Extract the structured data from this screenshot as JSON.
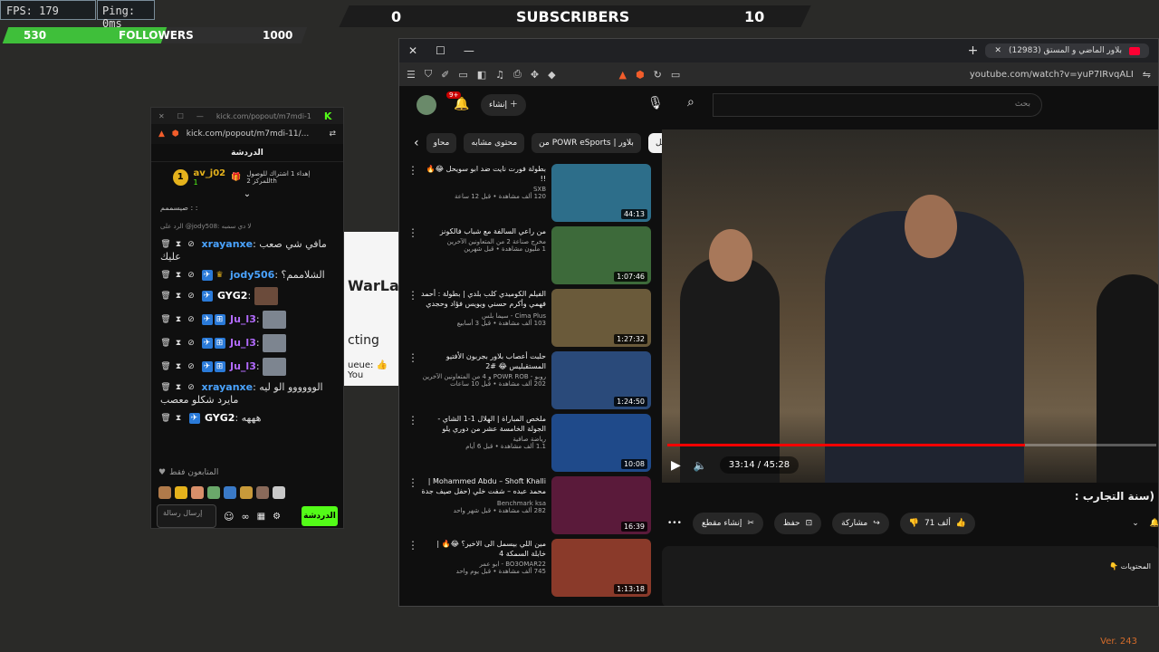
{
  "overlay": {
    "fps": "FPS: 179",
    "ping": "Ping: 0ms",
    "followers": {
      "current": "530",
      "label": "FOLLOWERS",
      "goal": "1000",
      "progress": 0.53
    },
    "subscribers": {
      "current": "0",
      "label": "SUBSCRIBERS",
      "goal": "10"
    },
    "version": "Ver. 243"
  },
  "kick": {
    "title": "kick.com/popout/m7mdi-1",
    "url": "kick.com/popout/m7mdi-11/...",
    "chat_header": "الدردشة",
    "pinned": {
      "rank": "1",
      "user": "av_j02",
      "sub": "1",
      "text": "إهداء 1 اشتراك للوصول للمركز 2th"
    },
    "messages": [
      {
        "user": "",
        "text": "صيسممم : :"
      },
      {
        "user": "",
        "text": "الرد على @jody508: لا دي سمبه"
      },
      {
        "user": "xrayanxe",
        "text": "مافي شي صعب عليك",
        "color": "#4aa3ff"
      },
      {
        "user": "jody506",
        "text": "الشلاممم؟",
        "color": "#4aa3ff"
      },
      {
        "user": "GYG2",
        "text": "",
        "color": "#ffffff"
      },
      {
        "user": "Ju_l3",
        "text": "",
        "color": "#b36bff"
      },
      {
        "user": "Ju_l3",
        "text": "",
        "color": "#b36bff"
      },
      {
        "user": "Ju_l3",
        "text": "",
        "color": "#b36bff"
      },
      {
        "user": "xrayanxe",
        "text": "الوووووو الو ليه مايرد شكلو معصب",
        "color": "#4aa3ff"
      },
      {
        "user": "GYG2",
        "text": "هههه",
        "color": "#ffffff"
      }
    ],
    "emote_label": "المتابعون فقط",
    "input_placeholder": "إرسال رسالة",
    "send_label": "الدردشة"
  },
  "dialog": {
    "heading": "WarLar",
    "body": "cting",
    "queue": "ueue: 👍 You"
  },
  "browser": {
    "tab_title": "(12983) بلاور الماضي و المستق",
    "url": "youtube.com/watch?v=yuP7IRvqALI",
    "notifications": "9+",
    "create_label": "إنشاء",
    "search_placeholder": "بحث",
    "chips": [
      "محاو",
      "محتوى مشابه",
      "من POWR eSports | بلاور",
      "الكل"
    ],
    "recommendations": [
      {
        "title": "بطولة فورت نايت ضد ابو سويحل 😂🔥 !!",
        "channel": "SXB",
        "meta": "120 ألف مشاهدة • قبل 12 ساعة",
        "duration": "44:13",
        "color": "#2d6e8a"
      },
      {
        "title": "من راعي السالفة مع شباب فالكونز",
        "channel": "مخرج صناعة 2 من المتعاونين الآخرين",
        "meta": "1 مليون مشاهدة • قبل شهرين",
        "duration": "1:07:46",
        "color": "#3d6a3a"
      },
      {
        "title": "الفيلم الكوميدي كلب بلدي | بطولة : أحمد فهمي وأكرم حسني ويويس فؤاد وحجدي ...",
        "channel": "Cima Plus - سيما بلس",
        "meta": "103 ألف مشاهدة • قبل 3 أسابيع",
        "duration": "1:27:32",
        "color": "#6a5a3a"
      },
      {
        "title": "حلبت أعصاب بلاور بجربون الأفتيو المستقبليس 😂 #2",
        "channel": "روبو - POWR ROB و 4 من المتعاونين الآخرين",
        "meta": "202 ألف مشاهدة • قبل 10 ساعات",
        "duration": "1:24:50",
        "color": "#2a4a7a"
      },
      {
        "title": "ملخص المباراة | الهلال 1-1 الشاي - الجولة الخامسة عشر من دوري يلو",
        "channel": "رياضة صافية",
        "meta": "1.1 ألف مشاهدة • قبل 6 أيام",
        "duration": "10:08",
        "color": "#1f4a8a"
      },
      {
        "title": "Mohammed Abdu – Shoft Khalli | محمد عبده – شفت خلي (حفل صيف جدة ...",
        "channel": "Benchmark ksa",
        "meta": "282 ألف مشاهدة • قبل شهر واحد",
        "duration": "16:39",
        "color": "#5a1a3a"
      },
      {
        "title": "مين اللي بيسمل الى الاخير؟ 😂🔥 | خابلة السمكة 4",
        "channel": "BO3OMAR22 - ابو عمر",
        "meta": "745 ألف مشاهدة • قبل يوم واحد",
        "duration": "1:13:18",
        "color": "#8a3a2a"
      }
    ],
    "player": {
      "time": "33:14 / 45:28",
      "progress": 0.731
    },
    "video_title": ": سنة التجارب)",
    "actions": {
      "likes": "71 ألف",
      "share": "مشاركة",
      "save": "حفظ",
      "clip": "إنشاء مقطع"
    },
    "description_snippet": "👇 المحتويات"
  }
}
